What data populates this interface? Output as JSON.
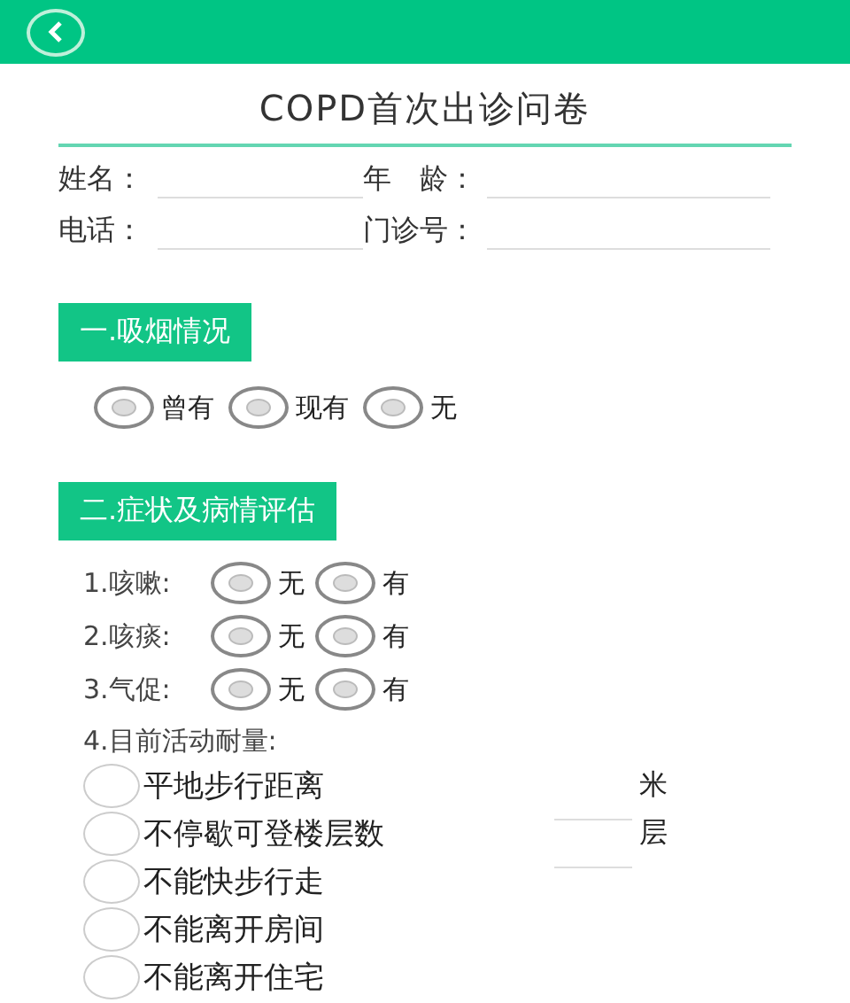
{
  "title": "COPD首次出诊问卷",
  "fields": [
    {
      "label": "姓名："
    },
    {
      "label": "年　龄："
    },
    {
      "label": "电话："
    },
    {
      "label": "门诊号："
    }
  ],
  "sections": [
    {
      "heading": "一.吸烟情况",
      "kind": "options",
      "options": [
        {
          "label": "曾有",
          "checked": false
        },
        {
          "label": "现有",
          "checked": false
        },
        {
          "label": "无",
          "checked": false
        }
      ]
    },
    {
      "heading": "二.症状及病情评估",
      "kind": "symptoms",
      "questions": [
        {
          "label": "1.咳嗽:",
          "options": [
            {
              "label": "无",
              "checked": false
            },
            {
              "label": "有",
              "checked": false
            }
          ]
        },
        {
          "label": "2.咳痰:",
          "options": [
            {
              "label": "无",
              "checked": false
            },
            {
              "label": "有",
              "checked": false
            }
          ]
        },
        {
          "label": "3.气促:",
          "options": [
            {
              "label": "无",
              "checked": false
            },
            {
              "label": "有",
              "checked": false
            }
          ]
        }
      ],
      "activity": {
        "label": "4.目前活动耐量:",
        "items": [
          {
            "kind": "input",
            "label": "平地步行距离",
            "unit": "米",
            "checked": false
          },
          {
            "kind": "input",
            "label": "不停歇可登楼层数",
            "unit": "层",
            "checked": false
          },
          {
            "kind": "plain",
            "label": "不能快步行走",
            "checked": false
          },
          {
            "kind": "plain",
            "label": "不能离开房间",
            "checked": false
          },
          {
            "kind": "plain",
            "label": "不能离开住宅",
            "checked": false
          }
        ]
      }
    }
  ]
}
